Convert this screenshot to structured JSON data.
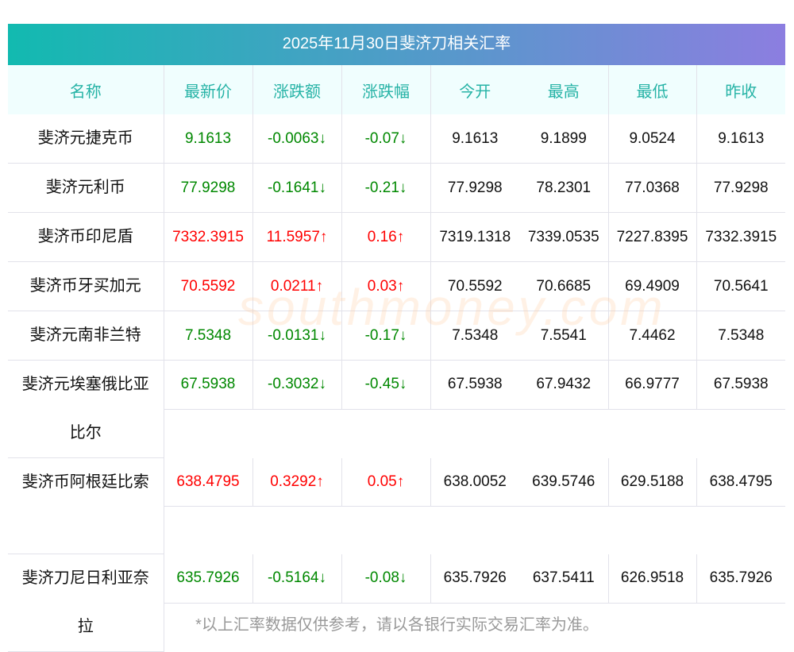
{
  "title": "2025年11月30日斐济刀相关汇率",
  "headers": [
    "名称",
    "最新价",
    "涨跌额",
    "涨跌幅",
    "今开",
    "最高",
    "最低",
    "昨收"
  ],
  "rows": [
    {
      "name": "斐济元捷克币",
      "latest": "9.1613",
      "change": "-0.0063↓",
      "pct": "-0.07↓",
      "open": "9.1613",
      "high": "9.1899",
      "low": "9.0524",
      "prev": "9.1613",
      "dir": "down"
    },
    {
      "name": "斐济元利币",
      "latest": "77.9298",
      "change": "-0.1641↓",
      "pct": "-0.21↓",
      "open": "77.9298",
      "high": "78.2301",
      "low": "77.0368",
      "prev": "77.9298",
      "dir": "down"
    },
    {
      "name": "斐济币印尼盾",
      "latest": "7332.3915",
      "change": "11.5957↑",
      "pct": "0.16↑",
      "open": "7319.1318",
      "high": "7339.0535",
      "low": "7227.8395",
      "prev": "7332.3915",
      "dir": "up"
    },
    {
      "name": "斐济币牙买加元",
      "latest": "70.5592",
      "change": "0.0211↑",
      "pct": "0.03↑",
      "open": "70.5592",
      "high": "70.6685",
      "low": "69.4909",
      "prev": "70.5641",
      "dir": "up"
    },
    {
      "name": "斐济元南非兰特",
      "latest": "7.5348",
      "change": "-0.0131↓",
      "pct": "-0.17↓",
      "open": "7.5348",
      "high": "7.5541",
      "low": "7.4462",
      "prev": "7.5348",
      "dir": "down"
    },
    {
      "name": "斐济元埃塞俄比亚比尔",
      "latest": "67.5938",
      "change": "-0.3032↓",
      "pct": "-0.45↓",
      "open": "67.5938",
      "high": "67.9432",
      "low": "66.9777",
      "prev": "67.5938",
      "dir": "down"
    },
    {
      "name": "斐济币阿根廷比索",
      "latest": "638.4795",
      "change": "0.3292↑",
      "pct": "0.05↑",
      "open": "638.0052",
      "high": "639.5746",
      "low": "629.5188",
      "prev": "638.4795",
      "dir": "up"
    },
    {
      "name": "斐济刀尼日利亚奈拉",
      "latest": "635.7926",
      "change": "-0.5164↓",
      "pct": "-0.08↓",
      "open": "635.7926",
      "high": "637.5411",
      "low": "626.9518",
      "prev": "635.7926",
      "dir": "down"
    }
  ],
  "watermark": "南方财富网 southmoney.com",
  "note": "*以上汇率数据仅供参考，请以各银行实际交易汇率为准。"
}
